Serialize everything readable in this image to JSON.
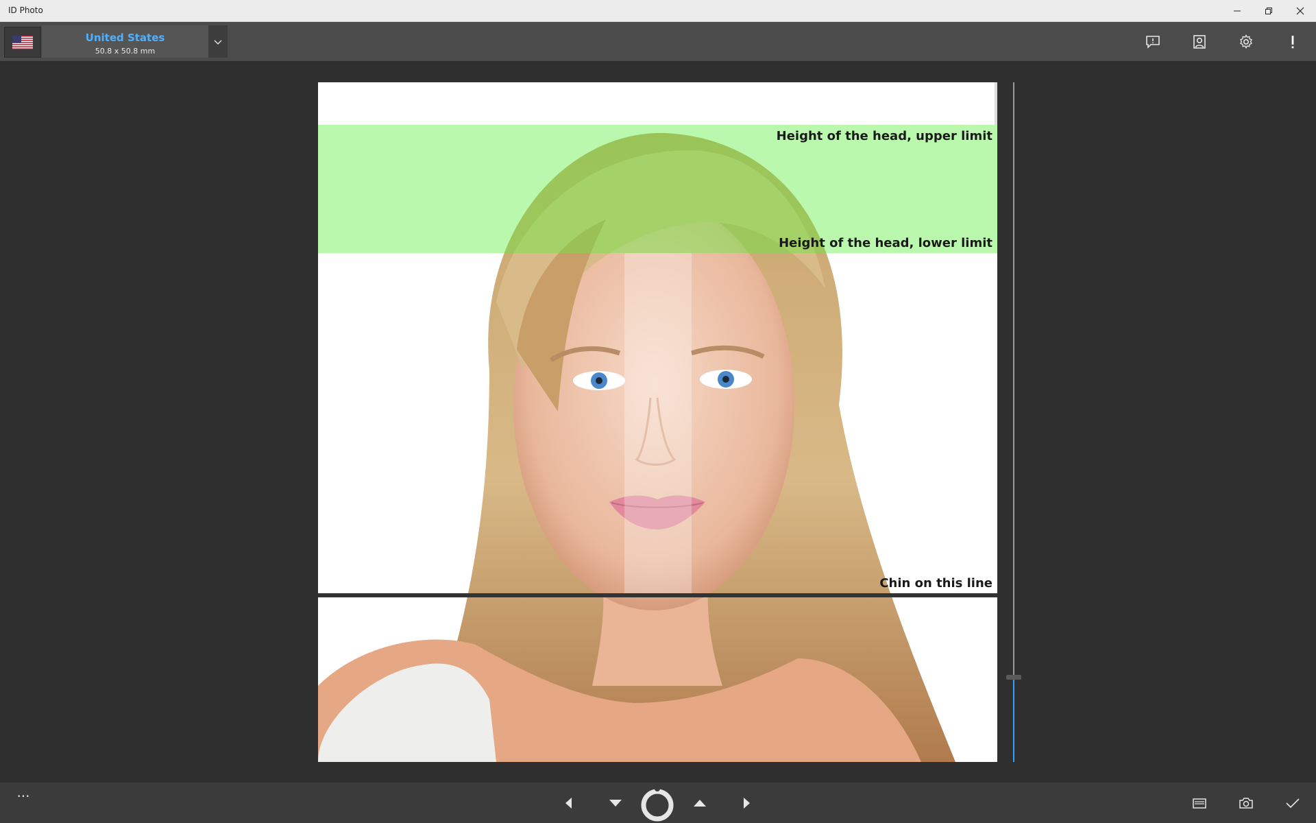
{
  "window": {
    "title": "ID Photo",
    "controls": [
      "minimize",
      "maximize",
      "close"
    ]
  },
  "toolbar": {
    "country": {
      "flag_icon": "us-flag-icon",
      "name": "United States",
      "size": "50.8 x 50.8 mm"
    },
    "dropdown_icon": "chevron-down-icon",
    "actions": [
      "feedback-icon",
      "portrait-icon",
      "gear-icon",
      "info-icon"
    ]
  },
  "photo": {
    "overlays": {
      "head_upper": "Height of the head, upper limit",
      "head_lower": "Height of the head, lower limit",
      "chin": "Chin on this line"
    },
    "colors": {
      "head_zone": "#5af03c",
      "chin_line": "#333333",
      "accent": "#2aa0ff"
    }
  },
  "bottombar": {
    "more_label": "···",
    "nav": [
      "triangle-left-icon",
      "triangle-down-icon",
      "rotate-ring-icon",
      "triangle-up-icon",
      "triangle-right-icon"
    ],
    "right_actions": [
      "gallery-icon",
      "camera-icon",
      "check-icon"
    ]
  }
}
